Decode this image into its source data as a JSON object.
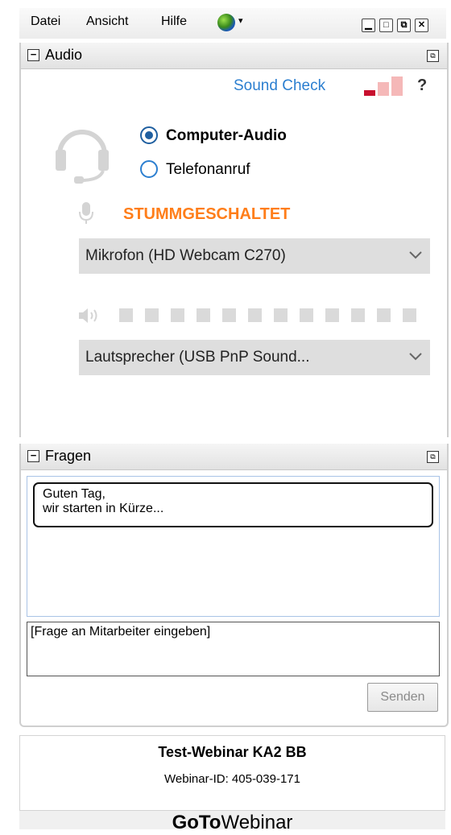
{
  "menu": {
    "items": [
      "Datei",
      "Ansicht",
      "Hilfe"
    ],
    "globe_icon": "globe-icon",
    "caret": "▾"
  },
  "window_controls": {
    "minimize": "▁",
    "maximize": "□",
    "restore": "⧉",
    "close": "✕"
  },
  "audio_panel": {
    "title": "Audio",
    "sound_check": "Sound Check",
    "help": "?",
    "options": [
      "Computer-Audio",
      "Telefonanruf"
    ],
    "selected_option": "Computer-Audio",
    "mute_status": "STUMMGESCHALTET",
    "mute_color": "#ff7e1a",
    "microphone": "Mikrofon (HD Webcam C270)",
    "speaker": "Lautsprecher (USB PnP Sound...",
    "speaker_level_segments": 12,
    "speaker_level": 0
  },
  "questions_panel": {
    "title": "Fragen",
    "messages": [
      "Guten Tag,\nwir starten in Kürze..."
    ],
    "input_placeholder": "[Frage an Mitarbeiter eingeben]",
    "send_label": "Senden"
  },
  "webinar": {
    "title": "Test-Webinar KA2 BB",
    "id_label": "Webinar-ID: 405-039-171"
  },
  "brand": {
    "bold": "GoTo",
    "regular": "Webinar"
  }
}
